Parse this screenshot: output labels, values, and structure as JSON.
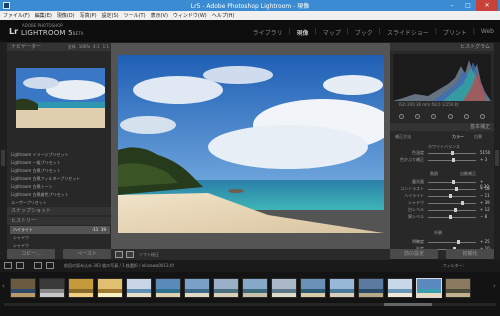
{
  "window": {
    "title": "Lr5 - Adobe Photoshop Lightroom - 現像",
    "buttons": [
      "–",
      "□",
      "✕"
    ]
  },
  "menu": [
    "ファイル(F)",
    "編集(E)",
    "現像(D)",
    "写真(P)",
    "設定(S)",
    "ツール(T)",
    "表示(V)",
    "ウィンドウ(W)",
    "ヘルプ(H)"
  ],
  "identity": {
    "logo": "Lr",
    "name": "LIGHTROOM 5",
    "suffix": "BETA",
    "sub": "ADOBE PHOTOSHOP"
  },
  "modules": [
    {
      "label": "ライブラリ",
      "active": false
    },
    {
      "label": "現像",
      "active": true
    },
    {
      "label": "マップ",
      "active": false
    },
    {
      "label": "ブック",
      "active": false
    },
    {
      "label": "スライドショー",
      "active": false
    },
    {
      "label": "プリント",
      "active": false
    },
    {
      "label": "Web",
      "active": false
    }
  ],
  "left_panel": {
    "navigator_title": "ナビゲーター",
    "nav_modes": [
      "全体",
      "100%",
      "4:1",
      "1:1"
    ],
    "presets": [
      "Lightroom イメージプリセット",
      "Lightroom 一般プリセット",
      "Lightroom 白黒プリセット",
      "Lightroom 白黒フィルタープリセット",
      "Lightroom 白黒トーン",
      "Lightroom 白黒着色プリセット",
      "ユーザープリセット"
    ],
    "snapshots_title": "スナップショット",
    "history_title": "ヒストリー",
    "history": [
      {
        "label": "ハイライト",
        "value": "-11",
        "value2": "39",
        "active": true
      },
      {
        "label": "シャドウ",
        "value": "",
        "value2": "",
        "active": false
      },
      {
        "label": "シャドウ",
        "value": "",
        "value2": "",
        "active": false
      }
    ],
    "copy_button": "コピー...",
    "paste_button": "ペースト"
  },
  "toolbar": {
    "label": "ソフト校正"
  },
  "right_panel": {
    "histogram_title": "ヒストグラム",
    "histogram_meta": "ISO 200   36 mm   f/8.0   1/250 秒",
    "basic_title": "基本補正",
    "treatment_label": "補正方法",
    "treatment_options": [
      "カラー",
      "白黒"
    ],
    "wb_label": "ホワイトバランス",
    "tone_label": "階調",
    "tone_auto": "自動補正",
    "presence_label": "外観",
    "sliders": [
      {
        "label": "色温度",
        "value": "5150",
        "pos": 0.5
      },
      {
        "label": "色かぶり補正",
        "value": "+ 3",
        "pos": 0.52
      },
      {
        "label": "露光量",
        "value": "+ 0.20",
        "pos": 0.52
      },
      {
        "label": "コントラスト",
        "value": "+ 18",
        "pos": 0.58
      },
      {
        "label": "ハイライト",
        "value": "− 11",
        "pos": 0.45
      },
      {
        "label": "シャドウ",
        "value": "+ 39",
        "pos": 0.7
      },
      {
        "label": "白レベル",
        "value": "+ 12",
        "pos": 0.56
      },
      {
        "label": "黒レベル",
        "value": "− 8",
        "pos": 0.46
      },
      {
        "label": "明瞭度",
        "value": "+ 25",
        "pos": 0.62
      },
      {
        "label": "彩度",
        "value": "+ 10",
        "pos": 0.55
      }
    ],
    "prev_button": "前の設定",
    "reset_button": "初期化"
  },
  "filmstrip_bar": {
    "path": "前回の読み込み   303 枚の写真 / 1 枚選択 / okinawa0013.tif",
    "filter_label": "フィルター:"
  },
  "colors": {
    "titlebar": "#3a8bd2",
    "panel": "#282828",
    "background": "#1f1f1f",
    "center_bg": "#545454"
  }
}
